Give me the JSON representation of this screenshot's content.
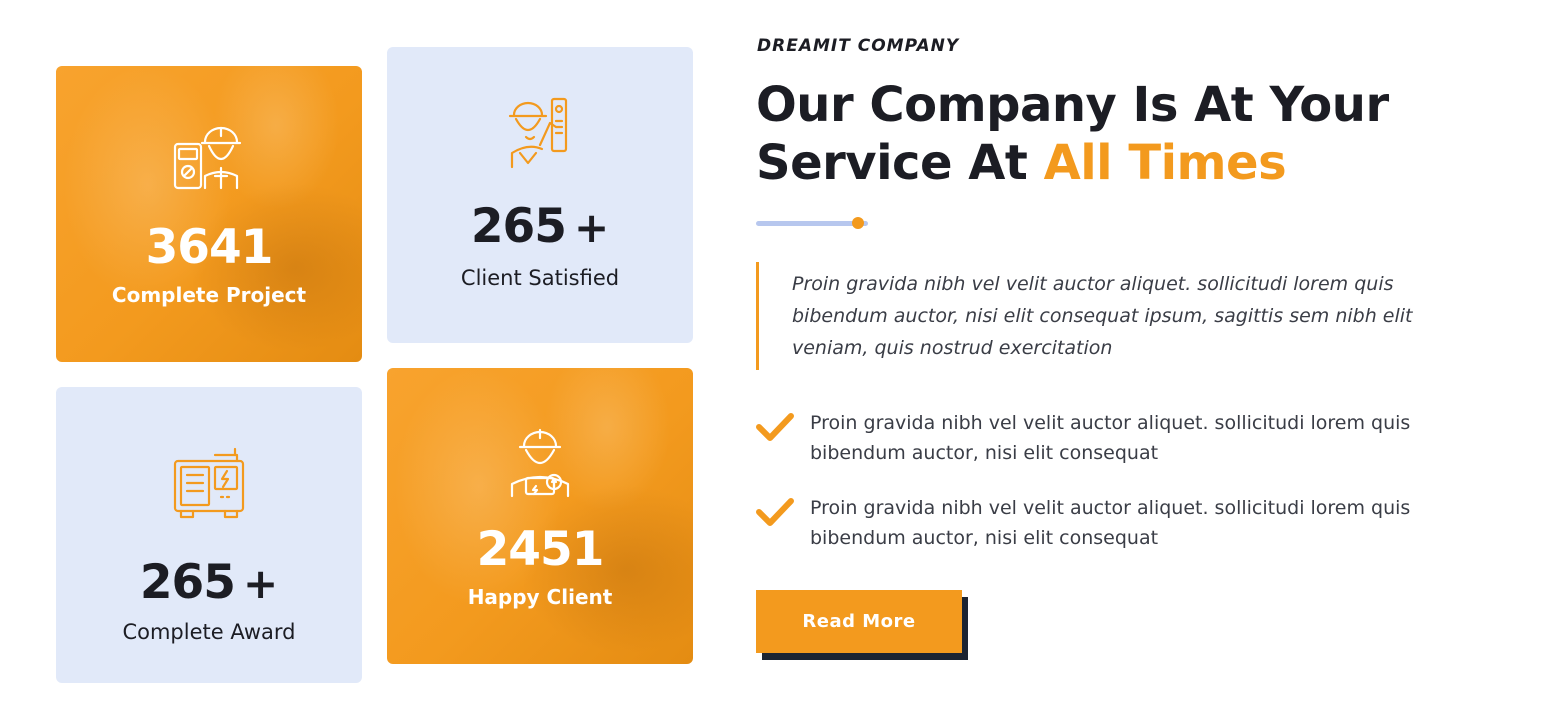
{
  "stats": [
    {
      "number": "3641",
      "plus": "",
      "label": "Complete Project",
      "icon": "electrician-multimeter-icon"
    },
    {
      "number": "265",
      "plus": "+",
      "label": "Client Satisfied",
      "icon": "technician-panel-icon"
    },
    {
      "number": "265",
      "plus": "+",
      "label": "Complete Award",
      "icon": "generator-icon"
    },
    {
      "number": "2451",
      "plus": "",
      "label": "Happy Client",
      "icon": "engineer-bulb-icon"
    }
  ],
  "about": {
    "eyebrow": "DREAMIT COMPANY",
    "title_line1": "Our Company Is At Your",
    "title_line2_prefix": "Service At ",
    "title_highlight": "All Times",
    "quote": "Proin gravida nibh vel velit auctor aliquet. sollicitudi lorem quis bibendum auctor, nisi elit consequat ipsum, sagittis sem nibh elit veniam, quis nostrud exercitation",
    "checklist": [
      {
        "text": "Proin gravida nibh vel velit auctor aliquet. sollicitudi lorem quis bibendum auctor, nisi elit consequat",
        "icon": "checkmark-icon"
      },
      {
        "text": "Proin gravida nibh vel velit auctor aliquet. sollicitudi lorem quis bibendum auctor, nisi elit consequat",
        "icon": "checkmark-icon"
      }
    ],
    "button_label": "Read More"
  },
  "colors": {
    "accent": "#f39a1e",
    "dark": "#1c1d24",
    "card_blue": "#e1e9f9",
    "divider": "#b7c7ee",
    "button_shadow": "#1c2432"
  }
}
